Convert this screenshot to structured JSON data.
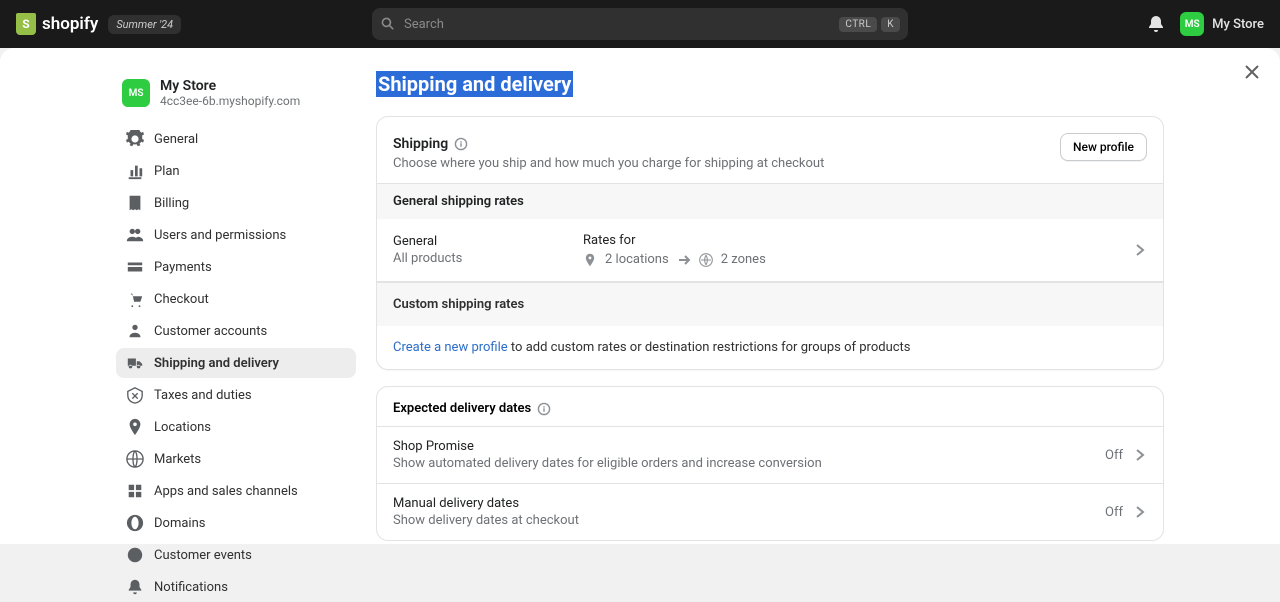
{
  "topbar": {
    "brand": "shopify",
    "badge": "Summer '24",
    "search_placeholder": "Search",
    "kbd1": "CTRL",
    "kbd2": "K",
    "store_name": "My Store",
    "avatar_initials": "MS"
  },
  "sidebar": {
    "store_name": "My Store",
    "store_domain": "4cc3ee-6b.myshopify.com",
    "avatar_initials": "MS",
    "items": [
      {
        "label": "General",
        "icon": "gear"
      },
      {
        "label": "Plan",
        "icon": "chart"
      },
      {
        "label": "Billing",
        "icon": "receipt"
      },
      {
        "label": "Users and permissions",
        "icon": "users"
      },
      {
        "label": "Payments",
        "icon": "card"
      },
      {
        "label": "Checkout",
        "icon": "cart"
      },
      {
        "label": "Customer accounts",
        "icon": "person"
      },
      {
        "label": "Shipping and delivery",
        "icon": "truck"
      },
      {
        "label": "Taxes and duties",
        "icon": "tax"
      },
      {
        "label": "Locations",
        "icon": "pin"
      },
      {
        "label": "Markets",
        "icon": "globe"
      },
      {
        "label": "Apps and sales channels",
        "icon": "grid"
      },
      {
        "label": "Domains",
        "icon": "domain"
      },
      {
        "label": "Customer events",
        "icon": "target"
      },
      {
        "label": "Notifications",
        "icon": "bell"
      }
    ],
    "active_index": 7
  },
  "page": {
    "title": "Shipping and delivery"
  },
  "shipping_card": {
    "heading": "Shipping",
    "description": "Choose where you ship and how much you charge for shipping at checkout",
    "new_profile_btn": "New profile",
    "general_rates_title": "General shipping rates",
    "general_label": "General",
    "general_sub": "All products",
    "rates_for_label": "Rates for",
    "locations_text": "2 locations",
    "zones_text": "2 zones",
    "custom_rates_title": "Custom shipping rates",
    "create_link": "Create a new profile",
    "create_rest": " to add custom rates or destination restrictions for groups of products"
  },
  "delivery_card": {
    "heading": "Expected delivery dates",
    "rows": [
      {
        "title": "Shop Promise",
        "sub": "Show automated delivery dates for eligible orders and increase conversion",
        "state": "Off"
      },
      {
        "title": "Manual delivery dates",
        "sub": "Show delivery dates at checkout",
        "state": "Off"
      }
    ]
  }
}
